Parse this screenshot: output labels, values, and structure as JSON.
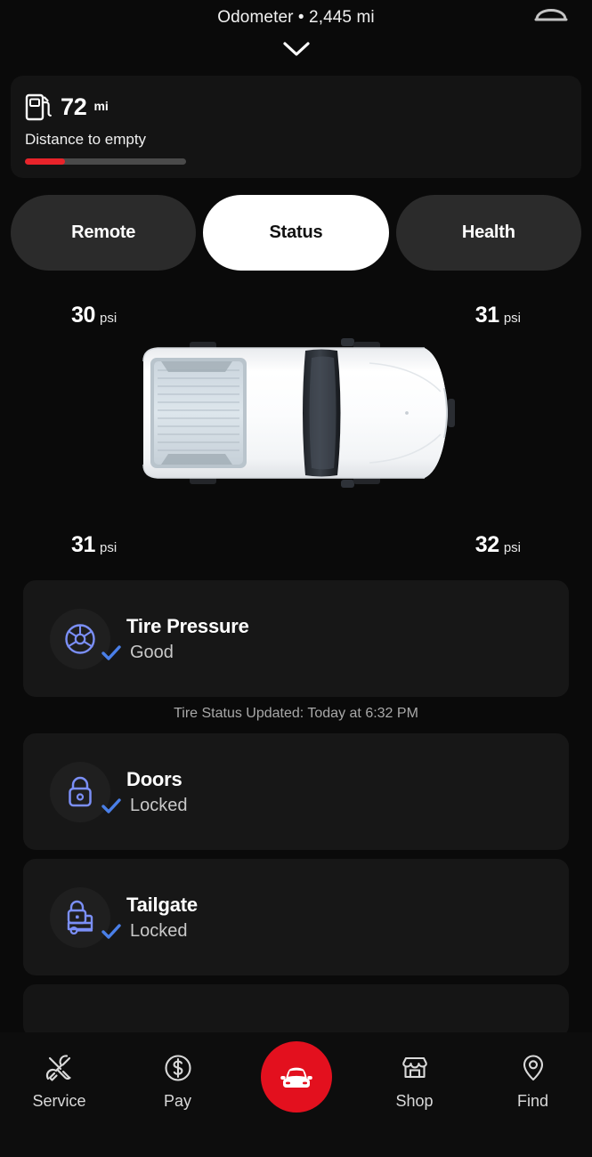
{
  "header": {
    "odometer_text": "Odometer • 2,445 mi",
    "collapse_icon": "chevron-down-icon",
    "top_right_icon": "vehicle-roof-icon"
  },
  "fuel": {
    "icon": "fuel-pump-icon",
    "value": "72",
    "unit": "mi",
    "label": "Distance to empty",
    "fill_percent": 25,
    "fill_color": "#e8232a",
    "track_color": "#4a4a4a"
  },
  "tabs": [
    {
      "label": "Remote",
      "active": false
    },
    {
      "label": "Status",
      "active": true
    },
    {
      "label": "Health",
      "active": false
    }
  ],
  "tires": {
    "front_left": {
      "value": "30",
      "unit": "psi"
    },
    "front_right": {
      "value": "31",
      "unit": "psi"
    },
    "rear_left": {
      "value": "31",
      "unit": "psi"
    },
    "rear_right": {
      "value": "32",
      "unit": "psi"
    },
    "vehicle_image": "pickup-truck-top-view"
  },
  "status_cards": [
    {
      "icon": "tire-wheel-icon",
      "title": "Tire Pressure",
      "status": "Good",
      "check_icon": "checkmark-icon"
    },
    {
      "icon": "lock-closed-icon",
      "title": "Doors",
      "status": "Locked",
      "check_icon": "checkmark-icon"
    },
    {
      "icon": "tailgate-lock-icon",
      "title": "Tailgate",
      "status": "Locked",
      "check_icon": "checkmark-icon"
    }
  ],
  "tire_updated_text": "Tire Status Updated:  Today at 6:32 PM",
  "bottom_nav": {
    "items": [
      {
        "label": "Service",
        "icon": "wrench-screwdriver-icon"
      },
      {
        "label": "Pay",
        "icon": "dollar-circle-icon"
      },
      {
        "label": "",
        "icon": "car-front-icon",
        "center": true
      },
      {
        "label": "Shop",
        "icon": "storefront-icon"
      },
      {
        "label": "Find",
        "icon": "location-pin-icon"
      }
    ],
    "center_color": "#e3101e"
  },
  "colors": {
    "accent_blue": "#7b8ff7",
    "check_blue": "#4a7fe8",
    "brand_red": "#e3101e",
    "page_bg": "#0a0a0a",
    "card_bg": "#171717"
  }
}
